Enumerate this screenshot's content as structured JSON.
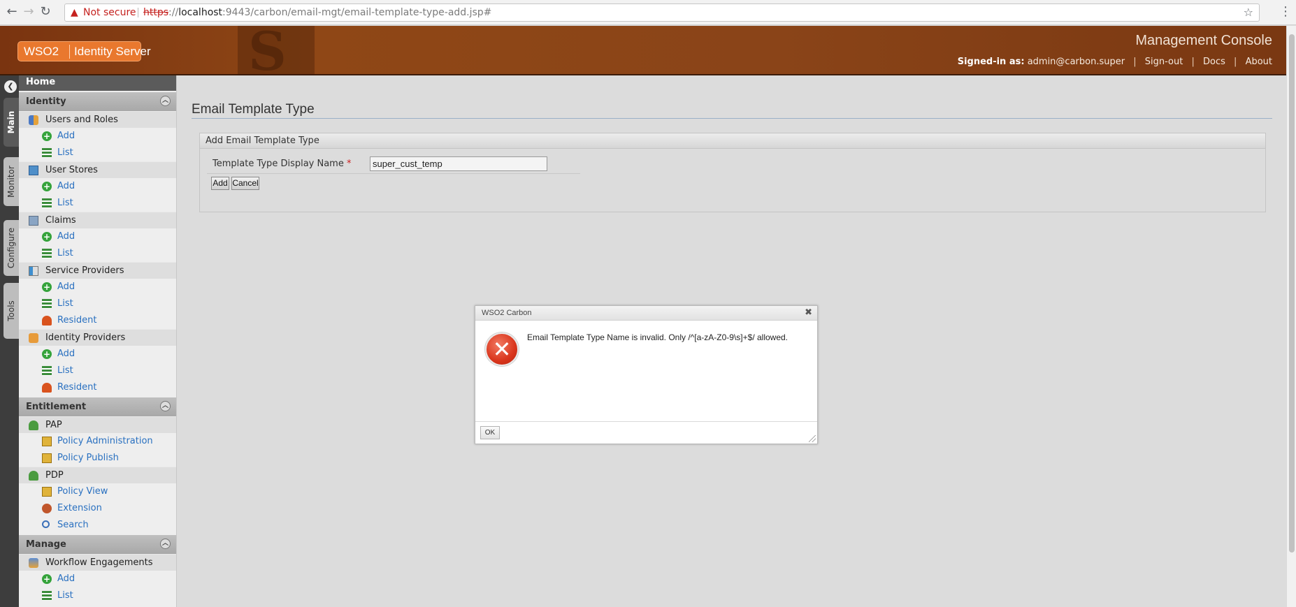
{
  "browser": {
    "back_icon": "arrow-left-icon",
    "forward_icon": "arrow-right-icon",
    "reload_icon": "reload-icon",
    "security_label": "Not secure",
    "url_scheme": "https",
    "url_host": "localhost",
    "url_rest": ":9443/carbon/email-mgt/email-template-type-add.jsp#",
    "bookmark_icon": "star-icon",
    "menu_icon": "kebab-menu-icon"
  },
  "header": {
    "logo_wso": "WSO2",
    "logo_product": "Identity Server",
    "console_title": "Management Console",
    "signed_in_label": "Signed-in as:",
    "signed_in_user": "admin@carbon.super",
    "links": [
      "Sign-out",
      "Docs",
      "About"
    ]
  },
  "vertical_tabs": [
    "Main",
    "Monitor",
    "Configure",
    "Tools"
  ],
  "sidebar": {
    "home": "Home",
    "sections": [
      {
        "title": "Identity",
        "categories": [
          {
            "label": "Users and Roles",
            "icon": "users-roles-icon",
            "items": [
              "Add",
              "List"
            ]
          },
          {
            "label": "User Stores",
            "icon": "user-store-icon",
            "items": [
              "Add",
              "List"
            ]
          },
          {
            "label": "Claims",
            "icon": "claims-icon",
            "items": [
              "Add",
              "List"
            ]
          },
          {
            "label": "Service Providers",
            "icon": "service-provider-icon",
            "items": [
              "Add",
              "List",
              "Resident"
            ]
          },
          {
            "label": "Identity Providers",
            "icon": "identity-provider-icon",
            "items": [
              "Add",
              "List",
              "Resident"
            ]
          }
        ]
      },
      {
        "title": "Entitlement",
        "categories": [
          {
            "label": "PAP",
            "icon": "pap-icon",
            "items": [
              "Policy Administration",
              "Policy Publish"
            ]
          },
          {
            "label": "PDP",
            "icon": "pdp-icon",
            "items": [
              "Policy View",
              "Extension",
              "Search"
            ]
          }
        ]
      },
      {
        "title": "Manage",
        "categories": [
          {
            "label": "Workflow Engagements",
            "icon": "workflow-icon",
            "items": [
              "Add",
              "List"
            ]
          }
        ]
      }
    ]
  },
  "main": {
    "page_title": "Email Template Type",
    "panel_title": "Add Email Template Type",
    "field_label": "Template Type Display Name",
    "required_mark": "*",
    "field_value": "super_cust_temp",
    "add_button": "Add",
    "cancel_button": "Cancel"
  },
  "dialog": {
    "title": "WSO2 Carbon",
    "close_icon": "close-icon",
    "icon": "error-icon",
    "message": "Email Template Type Name is invalid. Only /^[a-zA-Z0-9\\s]+$/ allowed.",
    "ok_button": "OK"
  },
  "colors": {
    "header_brown": "#8a4418",
    "logo_orange": "#e9782e",
    "link_blue": "#2970c0",
    "error_red": "#d9351c"
  }
}
